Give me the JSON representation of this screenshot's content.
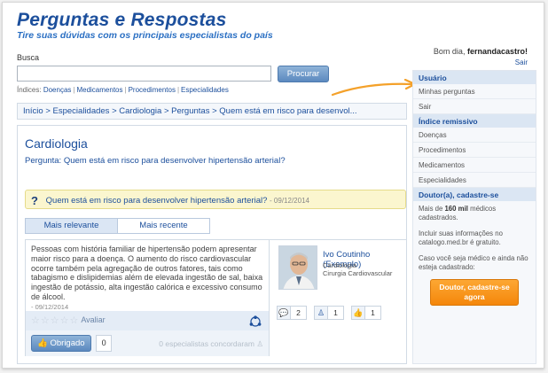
{
  "header": {
    "title": "Perguntas e Respostas",
    "subtitle": "Tire suas dúvidas com os principais especialistas do país",
    "greeting_prefix": "Bom dia,",
    "username": "fernandacastro!",
    "logout": "Sair"
  },
  "search": {
    "label": "Busca",
    "value": "",
    "button": "Procurar",
    "indices_label": "Índices:",
    "indices": [
      "Doenças",
      "Medicamentos",
      "Procedimentos",
      "Especialidades"
    ]
  },
  "breadcrumb": "Início > Especialidades > Cardiologia > Perguntas > Quem está em risco para desenvol...",
  "main": {
    "title": "Cardiologia",
    "pergunta": "Pergunta: Quem está em risco para desenvolver hipertensão arterial?",
    "question_text": "Quem está em risco para desenvolver hipertensão arterial?",
    "question_date": "- 09/12/2014",
    "tabs": [
      {
        "label": "Mais relevante",
        "active": true
      },
      {
        "label": "Mais recente",
        "active": false
      }
    ]
  },
  "answer": {
    "text": "Pessoas com história familiar de hipertensão podem apresentar maior risco para a doença. O aumento do risco cardiovascular ocorre também pela agregação de outros fatores, tais como tabagismo e dislipidemias além de elevada ingestão de sal, baixa ingestão de potássio, alta ingestão calórica e excessivo consumo de álcool.",
    "date": "- 09/12/2014",
    "rate_label": "Avaliar",
    "thanks_button": "Obrigado",
    "thanks_count": "0",
    "agree_text": "0 especialistas concordaram",
    "expert": {
      "name": "Ivo Coutinho (Exemplo)",
      "specialty_1": "Cardiologia",
      "specialty_2": "Cirurgia Cardiovascular",
      "stats": [
        {
          "icon": "speech-bubble-icon",
          "value": "2"
        },
        {
          "icon": "person-icon",
          "value": "1"
        },
        {
          "icon": "thumbs-up-icon",
          "value": "1"
        }
      ]
    }
  },
  "sidebar": {
    "usuario_head": "Usuário",
    "usuario_items": [
      "Minhas perguntas",
      "Sair"
    ],
    "indice_head": "Índice remissivo",
    "indice_items": [
      "Doenças",
      "Procedimentos",
      "Medicamentos",
      "Especialidades"
    ],
    "doutor_head": "Doutor(a), cadastre-se",
    "doutor_text_pre": "Mais de ",
    "doutor_text_bold": "160 mil",
    "doutor_text_post": " médicos cadastrados.",
    "info_text": "Incluir suas informações no catalogo.med.br é gratuito.",
    "case_text": "Caso você seja médico e ainda não esteja cadastrado:",
    "cta": "Doutor, cadastre-se agora"
  },
  "colors": {
    "brand_blue": "#1c4f9c",
    "accent_orange": "#f4870b",
    "question_bg": "#fbf6cf"
  }
}
